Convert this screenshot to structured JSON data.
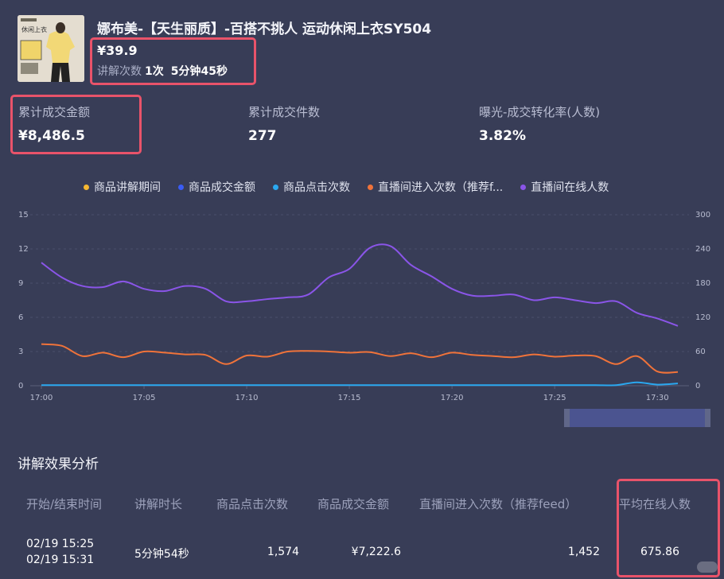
{
  "product": {
    "thumbnail_text": "休闲上衣",
    "title": "娜布美-【天生丽质】-百搭不挑人 运动休闲上衣SY504",
    "price": "¥39.9",
    "explain_label": "讲解次数",
    "explain_count": "1次",
    "explain_duration": "5分钟45秒"
  },
  "stats": [
    {
      "label": "累计成交金额",
      "value": "¥8,486.5"
    },
    {
      "label": "累计成交件数",
      "value": "277"
    },
    {
      "label": "曝光-成交转化率(人数)",
      "value": "3.82%"
    }
  ],
  "legend": [
    {
      "name": "商品讲解期间",
      "color": "#f5b731"
    },
    {
      "name": "商品成交金额",
      "color": "#3a5cf5"
    },
    {
      "name": "商品点击次数",
      "color": "#2aa8f0"
    },
    {
      "name": "直播间进入次数（推荐f...",
      "color": "#f0733a"
    },
    {
      "name": "直播间在线人数",
      "color": "#8a55e8"
    }
  ],
  "chart_data": {
    "type": "line",
    "x": [
      "17:00",
      "17:01",
      "17:02",
      "17:03",
      "17:04",
      "17:05",
      "17:06",
      "17:07",
      "17:08",
      "17:09",
      "17:10",
      "17:11",
      "17:12",
      "17:13",
      "17:14",
      "17:15",
      "17:16",
      "17:17",
      "17:18",
      "17:19",
      "17:20",
      "17:21",
      "17:22",
      "17:23",
      "17:24",
      "17:25",
      "17:26",
      "17:27",
      "17:28",
      "17:29",
      "17:30",
      "17:31"
    ],
    "x_tick_labels": [
      "17:00",
      "17:05",
      "17:10",
      "17:15",
      "17:20",
      "17:25",
      "17:30"
    ],
    "y_left_ticks": [
      "0",
      "3",
      "6",
      "9",
      "12",
      "15"
    ],
    "y_right_ticks": [
      "0",
      "60",
      "120",
      "180",
      "240",
      "300"
    ],
    "ylim_left": [
      0,
      15
    ],
    "ylim_right": [
      0,
      300
    ],
    "series": [
      {
        "name": "直播间在线人数",
        "axis": "right",
        "color": "#8a55e8",
        "values": [
          216,
          190,
          175,
          173,
          183,
          170,
          166,
          175,
          170,
          148,
          148,
          152,
          155,
          160,
          190,
          205,
          242,
          245,
          212,
          192,
          170,
          158,
          158,
          160,
          150,
          155,
          150,
          145,
          148,
          128,
          118,
          105
        ]
      },
      {
        "name": "直播间进入次数（推荐f...",
        "axis": "right",
        "color": "#f0733a",
        "values": [
          73,
          70,
          52,
          58,
          50,
          60,
          58,
          55,
          54,
          38,
          53,
          51,
          60,
          61,
          60,
          58,
          59,
          52,
          57,
          50,
          58,
          54,
          52,
          50,
          55,
          51,
          53,
          52,
          38,
          52,
          25,
          24
        ]
      },
      {
        "name": "商品点击次数",
        "axis": "left",
        "color": "#2aa8f0",
        "values": [
          0.05,
          0.05,
          0.05,
          0.05,
          0.05,
          0.05,
          0.05,
          0.05,
          0.05,
          0.05,
          0.05,
          0.05,
          0.05,
          0.05,
          0.05,
          0.05,
          0.05,
          0.05,
          0.05,
          0.05,
          0.05,
          0.05,
          0.05,
          0.05,
          0.05,
          0.05,
          0.05,
          0.05,
          0.05,
          0.3,
          0.1,
          0.2
        ]
      }
    ]
  },
  "section_title": "讲解效果分析",
  "table": {
    "headers": [
      "开始/结束时间",
      "讲解时长",
      "商品点击次数",
      "商品成交金额",
      "直播间进入次数（推荐feed）",
      "平均在线人数"
    ],
    "row": {
      "start": "02/19 15:25",
      "end": "02/19 15:31",
      "duration": "5分钟54秒",
      "clicks": "1,574",
      "gmv": "¥7,222.6",
      "entries": "1,452",
      "avg_online": "675.86"
    }
  }
}
